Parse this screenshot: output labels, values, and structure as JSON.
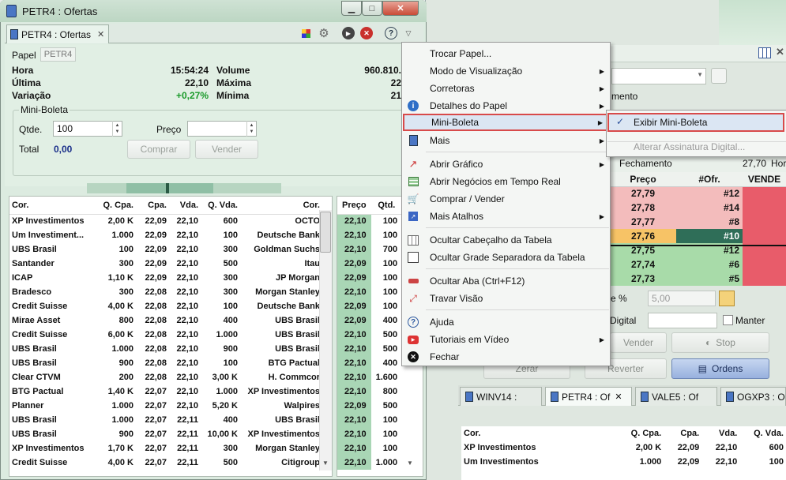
{
  "background": {
    "pill": "mento",
    "fechamento_label": "Fechamento",
    "fechamento_value": "27,70",
    "hora_cut": "Hor",
    "book_headers": [
      "Preço",
      "#Ofr.",
      "VENDE"
    ],
    "book_rows": [
      {
        "price": "27,79",
        "ofr": "#12",
        "bg": "#f3bcbc"
      },
      {
        "price": "27,78",
        "ofr": "#14",
        "bg": "#f3bcbc"
      },
      {
        "price": "27,77",
        "ofr": "#8",
        "bg": "#f3bcbc"
      },
      {
        "price": "27,76",
        "ofr": "#10",
        "bg": "#f7c366"
      },
      {
        "price": "27,75",
        "ofr": "#12",
        "bg": "#a8dba9"
      },
      {
        "price": "27,74",
        "ofr": "#6",
        "bg": "#a8dba9"
      },
      {
        "price": "27,73",
        "ofr": "#5",
        "bg": "#a8dba9"
      }
    ],
    "pct_label": "e %",
    "pct_value": "5,00",
    "digital_label": "Digital",
    "manter_label": "Manter",
    "vender_label": "Vender",
    "stop_label": "Stop",
    "zerar_label": "Zerar",
    "reverter_label": "Reverter",
    "ordens_label": "Ordens",
    "tabs": [
      "WINV14 :",
      "PETR4 : Of",
      "VALE5 : Of",
      "OGXP3 : O"
    ],
    "table_headers": [
      "Cor.",
      "Q. Cpa.",
      "Cpa.",
      "Vda.",
      "Q. Vda."
    ],
    "table_rows": [
      [
        "XP Investimentos",
        "2,00 K",
        "22,09",
        "22,10",
        "600"
      ],
      [
        "Um Investimentos",
        "1.000",
        "22,09",
        "22,10",
        "100"
      ]
    ]
  },
  "window": {
    "title": "PETR4 : Ofertas",
    "tab_label": "PETR4 : Ofertas",
    "papel_label": "Papel",
    "papel_value": "PETR4",
    "hora_label": "Hora",
    "hora_value": "15:54:24",
    "ultima_label": "Última",
    "ultima_value": "22,10",
    "variacao_label": "Variação",
    "variacao_value": "+0,27%",
    "volume_label": "Volume",
    "volume_value": "960.810.",
    "maxima_label": "Máxima",
    "maxima_value": "22",
    "minima_label": "Mínima",
    "minima_value": "21",
    "mini_boleta_title": "Mini-Boleta",
    "qtde_label": "Qtde.",
    "qtde_value": "100",
    "preco_label": "Preço",
    "total_label": "Total",
    "total_value": "0,00",
    "comprar_label": "Comprar",
    "vender_label": "Vender"
  },
  "offers": {
    "headers": [
      "Cor.",
      "Q. Cpa.",
      "Cpa.",
      "Vda.",
      "Q. Vda.",
      "Cor."
    ],
    "rows": [
      [
        "XP Investimentos",
        "2,00 K",
        "22,09",
        "22,10",
        "600",
        "OCTO"
      ],
      [
        "Um Investiment...",
        "1.000",
        "22,09",
        "22,10",
        "100",
        "Deutsche Bank"
      ],
      [
        "UBS Brasil",
        "100",
        "22,09",
        "22,10",
        "300",
        "Goldman Suchs"
      ],
      [
        "Santander",
        "300",
        "22,09",
        "22,10",
        "500",
        "Itau"
      ],
      [
        "ICAP",
        "1,10 K",
        "22,09",
        "22,10",
        "300",
        "JP Morgan"
      ],
      [
        "Bradesco",
        "300",
        "22,08",
        "22,10",
        "300",
        "Morgan Stanley"
      ],
      [
        "Credit Suisse",
        "4,00 K",
        "22,08",
        "22,10",
        "100",
        "Deutsche Bank"
      ],
      [
        "Mirae Asset",
        "800",
        "22,08",
        "22,10",
        "400",
        "UBS Brasil"
      ],
      [
        "Credit Suisse",
        "6,00 K",
        "22,08",
        "22,10",
        "1.000",
        "UBS Brasil"
      ],
      [
        "UBS Brasil",
        "1.000",
        "22,08",
        "22,10",
        "900",
        "UBS Brasil"
      ],
      [
        "UBS Brasil",
        "900",
        "22,08",
        "22,10",
        "100",
        "BTG Pactual"
      ],
      [
        "Clear CTVM",
        "200",
        "22,08",
        "22,10",
        "3,00 K",
        "H. Commcor"
      ],
      [
        "BTG Pactual",
        "1,40 K",
        "22,07",
        "22,10",
        "1.000",
        "XP Investimentos"
      ],
      [
        "Planner",
        "1.000",
        "22,07",
        "22,10",
        "5,20 K",
        "Walpires"
      ],
      [
        "UBS Brasil",
        "1.000",
        "22,07",
        "22,11",
        "400",
        "UBS Brasil"
      ],
      [
        "UBS Brasil",
        "900",
        "22,07",
        "22,11",
        "10,00 K",
        "XP Investimentos"
      ],
      [
        "XP Investimentos",
        "1,70 K",
        "22,07",
        "22,11",
        "300",
        "Morgan Stanley"
      ],
      [
        "Credit Suisse",
        "4,00 K",
        "22,07",
        "22,11",
        "500",
        "Citigroup"
      ]
    ]
  },
  "trades": {
    "headers": [
      "Preço",
      "Qtd."
    ],
    "rows": [
      [
        "22,10",
        "100"
      ],
      [
        "22,10",
        "100"
      ],
      [
        "22,10",
        "700"
      ],
      [
        "22,09",
        "100"
      ],
      [
        "22,09",
        "100"
      ],
      [
        "22,10",
        "100"
      ],
      [
        "22,09",
        "100"
      ],
      [
        "22,09",
        "400"
      ],
      [
        "22,10",
        "500"
      ],
      [
        "22,10",
        "500"
      ],
      [
        "22,10",
        "400"
      ],
      [
        "22,10",
        "1.600"
      ],
      [
        "22,10",
        "800"
      ],
      [
        "22,09",
        "500"
      ],
      [
        "22,10",
        "100"
      ],
      [
        "22,10",
        "100"
      ],
      [
        "22,10",
        "100"
      ],
      [
        "22,10",
        "1.000"
      ]
    ]
  },
  "menu": {
    "items": [
      "Trocar Papel...",
      "Modo de Visualização",
      "Corretoras",
      "Detalhes do Papel",
      "Mini-Boleta",
      "Mais",
      "Abrir Gráfico",
      "Abrir Negócios em Tempo Real",
      "Comprar / Vender",
      "Mais Atalhos",
      "Ocultar Cabeçalho da Tabela",
      "Ocultar Grade Separadora da Tabela",
      "Ocultar Aba (Ctrl+F12)",
      "Travar Visão",
      "Ajuda",
      "Tutoriais em Vídeo",
      "Fechar"
    ],
    "submenu": [
      "Exibir Mini-Boleta",
      "Alterar Assinatura Digital..."
    ]
  }
}
